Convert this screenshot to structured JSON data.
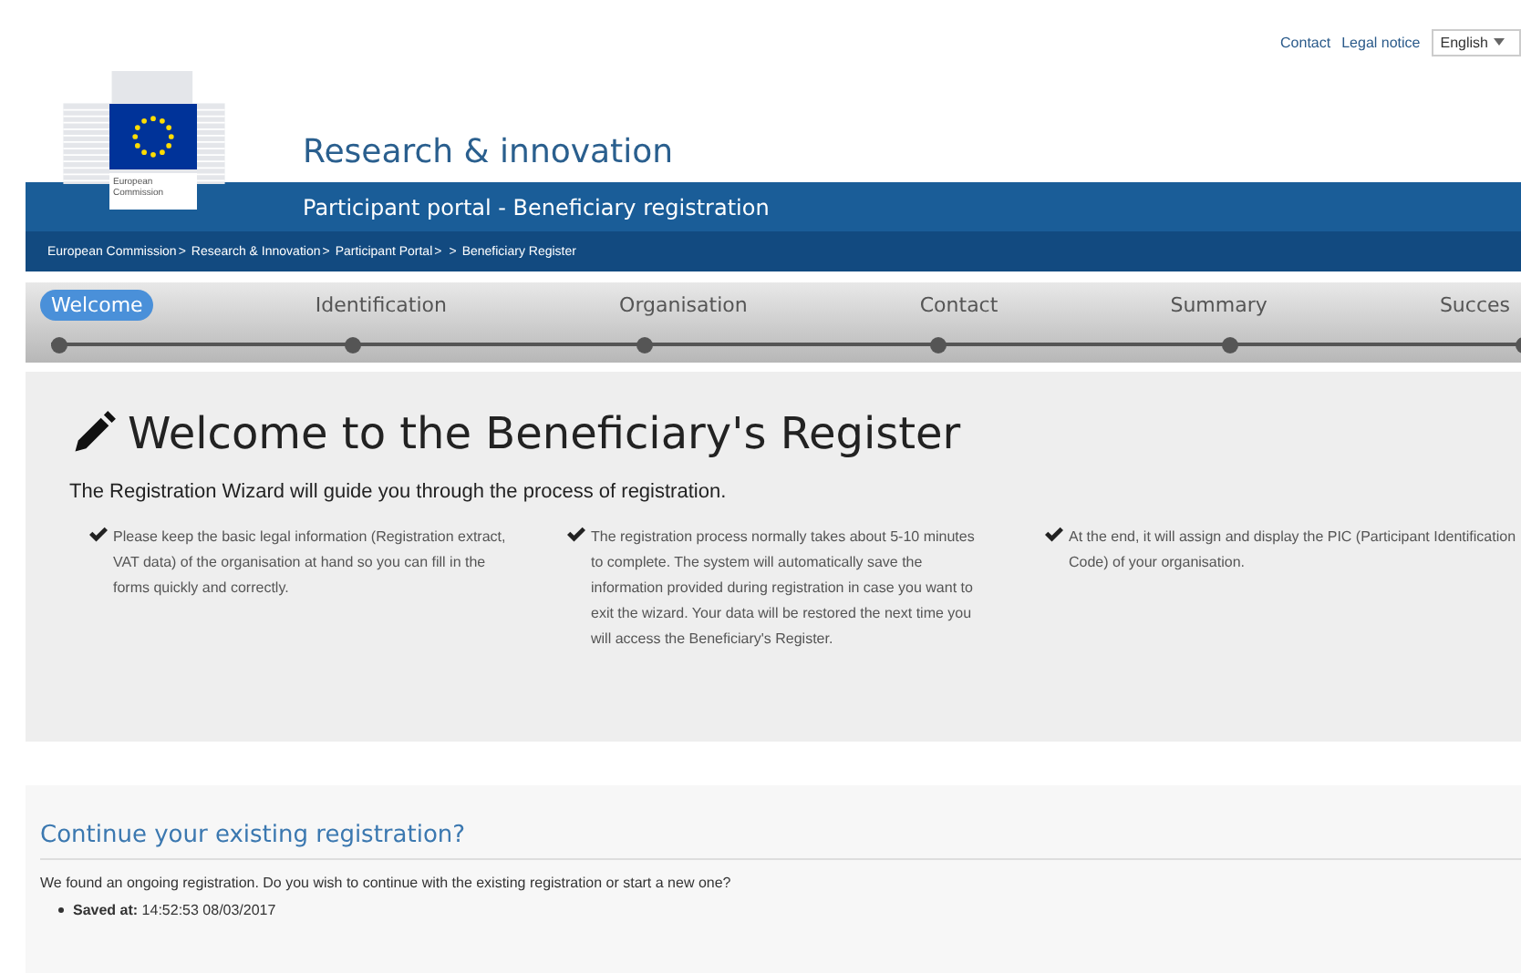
{
  "top_links": [
    "Contact",
    "Legal notice"
  ],
  "language": {
    "value": "English"
  },
  "logo": {
    "line1": "European",
    "line2": "Commission"
  },
  "header": {
    "title": "Research & innovation",
    "subtitle": "Participant portal - Beneficiary registration"
  },
  "breadcrumb": [
    {
      "kind": "link",
      "text": "European Commission"
    },
    {
      "kind": "separator",
      "text": ">"
    },
    {
      "kind": "link",
      "text": "Research & Innovation"
    },
    {
      "kind": "separator",
      "text": ">"
    },
    {
      "kind": "link",
      "text": "Participant Portal"
    },
    {
      "kind": "separator",
      "text": ">"
    },
    {
      "kind": "separator",
      "text": ">"
    },
    {
      "kind": "link",
      "text": "Beneficiary Register"
    }
  ],
  "steps": [
    {
      "label": "Welcome",
      "selected": true
    },
    {
      "label": "Identification",
      "selected": false
    },
    {
      "label": "Organisation",
      "selected": false
    },
    {
      "label": "Contact",
      "selected": false
    },
    {
      "label": "Summary",
      "selected": false
    },
    {
      "label": "Succes",
      "selected": false
    }
  ],
  "welcome": {
    "title": "Welcome to the Beneficiary's Register",
    "intro": "The Registration Wizard will guide you through the process of registration.",
    "points": [
      "Please keep the basic legal information (Registration extract, VAT data) of the organisation at hand so you can fill in the forms quickly and correctly.",
      "The registration process normally takes about 5-10 minutes to complete. The system will automatically save the information provided during registration in case you want to exit the wizard. Your data will be restored the next time you will access the Beneficiary's Register.",
      "At the end, it will assign and display the PIC (Participant Identification Code) of your organisation."
    ]
  },
  "continue": {
    "title": "Continue your existing registration?",
    "text": "We found an ongoing registration. Do you wish to continue with the existing registration or start a new one?",
    "saved": "**Saved at:** 14:52:53 08/03/2017"
  }
}
